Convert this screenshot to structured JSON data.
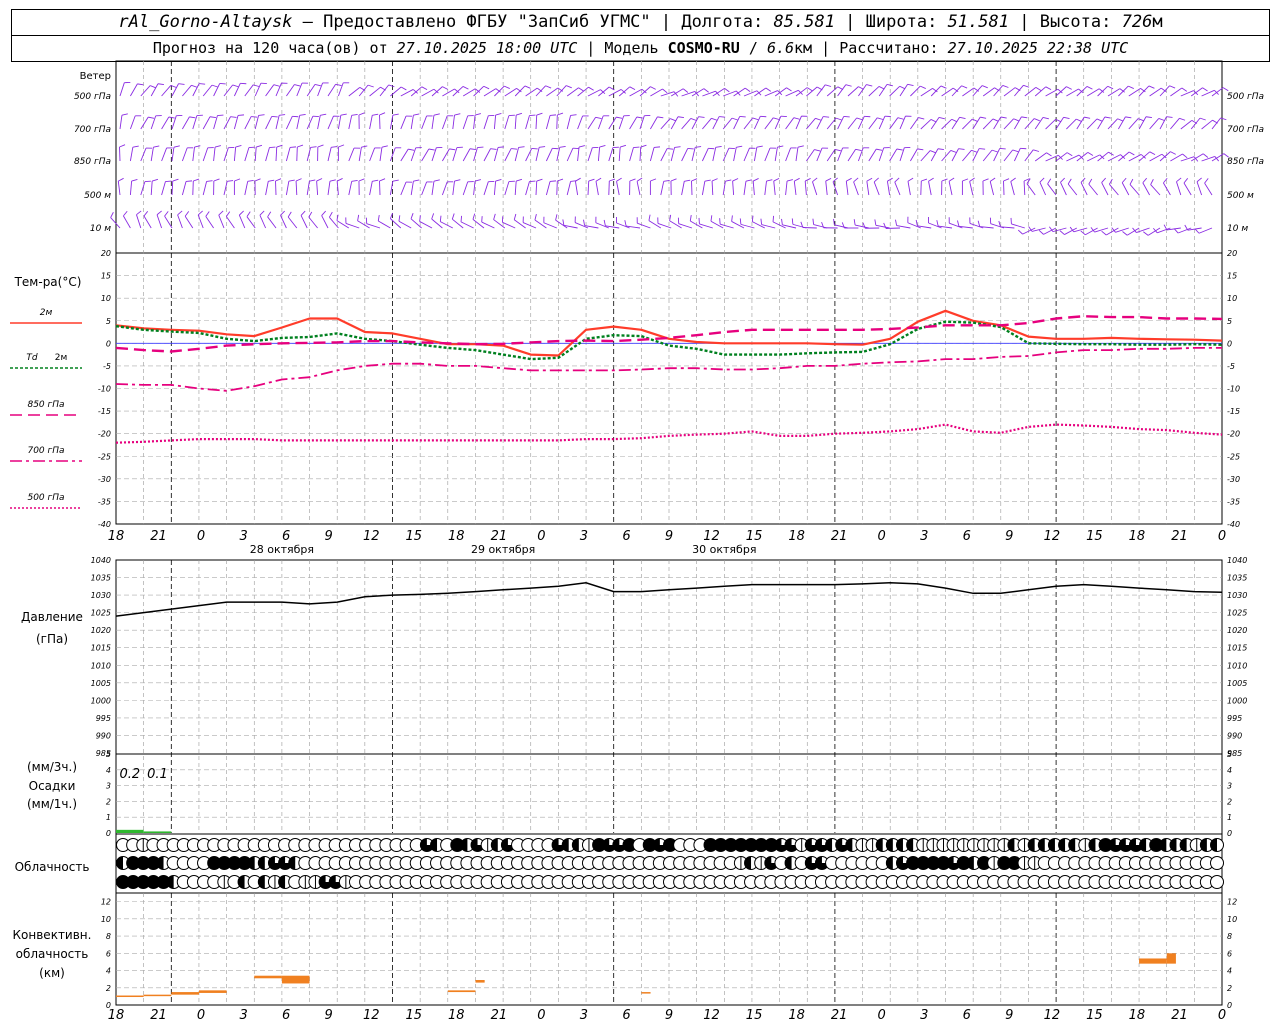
{
  "header": {
    "station": "rAl_Gorno-Altaysk",
    "provider": "Предоставлено ФГБУ \"ЗапСиб УГМС\"",
    "lon_label": "Долгота:",
    "lon": "85.581",
    "lat_label": "Широта:",
    "lat": "51.581",
    "alt_label": "Высота:",
    "alt": "726",
    "alt_unit": "м",
    "forecast_label": "Прогноз на 120 часа(ов) от",
    "forecast_start": "27.10.2025 18:00 UTC",
    "model_label": "Модель",
    "model": "COSMO-RU",
    "resolution": "6.6",
    "resolution_unit": "км",
    "computed_label": "Рассчитано:",
    "computed": "27.10.2025 22:38 UTC"
  },
  "colors": {
    "t2m": "#ff3c2a",
    "td": "#00801f",
    "t850": "#e6007e",
    "t700": "#e6007e",
    "t500": "#e6007e",
    "pressure": "#000000",
    "precip": "#2eb82e",
    "conv": "#f08020",
    "wind": "#8a2be2",
    "zero_line": "#3a3aff"
  },
  "wind_panel": {
    "title": "Ветер",
    "levels": [
      "500 гПа",
      "700 гПа",
      "850 гПа",
      "500 м",
      "10  м"
    ]
  },
  "time_axis": {
    "tick_labels": [
      "18",
      "21",
      "0",
      "3",
      "6",
      "9",
      "12",
      "15",
      "18",
      "21",
      "0",
      "3",
      "6",
      "9",
      "12",
      "15",
      "18",
      "21",
      "0",
      "3",
      "6",
      "9",
      "12",
      "15",
      "18",
      "21",
      "0"
    ],
    "dates": [
      "28 октября",
      "29 октября",
      "30 октября"
    ]
  },
  "chart_data": [
    {
      "type": "line",
      "panel": "temperature",
      "ylabel": "Тем-ра(°C)",
      "ylim": [
        -40,
        20
      ],
      "yticks": [
        20,
        15,
        10,
        5,
        0,
        -5,
        -10,
        -15,
        -20,
        -25,
        -30,
        -35,
        -40
      ],
      "x_hours": [
        0,
        3,
        6,
        9,
        12,
        15,
        18,
        21,
        24,
        27,
        30,
        33,
        36,
        39,
        42,
        45,
        48,
        51,
        54,
        57,
        60,
        63,
        66,
        69,
        72,
        75,
        78,
        81,
        84,
        87,
        90,
        93,
        96,
        99,
        102,
        105,
        108,
        111,
        114,
        117,
        120
      ],
      "series": [
        {
          "name": "2м",
          "values": [
            4,
            3.3,
            3,
            2.8,
            2,
            1.6,
            3.5,
            5.5,
            5.5,
            2.5,
            2.2,
            1,
            -0.2,
            -0.2,
            -0.5,
            -2.5,
            -2.7,
            3,
            3.7,
            3,
            1,
            0.3,
            0,
            0,
            0,
            0,
            -0.2,
            -0.3,
            1,
            4.8,
            7.2,
            5,
            4,
            1.5,
            1,
            1,
            1.2,
            1,
            0.9,
            0.8,
            0.6
          ]
        },
        {
          "name": "Td 2м",
          "values": [
            3.8,
            3,
            2.6,
            2.3,
            1,
            0.5,
            1.2,
            1.4,
            2.2,
            1,
            0.5,
            -0.3,
            -1,
            -1.5,
            -2.5,
            -3.5,
            -3.2,
            1,
            1.8,
            1.6,
            -0.5,
            -1.2,
            -2.5,
            -2.5,
            -2.5,
            -2.2,
            -2,
            -1.9,
            -0.2,
            3.2,
            4.8,
            4.6,
            3.6,
            0,
            -0.1,
            -0.2,
            -0.2,
            -0.3,
            -0.3,
            -0.2,
            -0.3
          ]
        },
        {
          "name": "850 гПа",
          "values": [
            -1,
            -1.5,
            -1.8,
            -1.2,
            -0.5,
            -0.2,
            0,
            0.1,
            0.2,
            0.5,
            0.5,
            0.2,
            0,
            -0.2,
            -0.1,
            0.2,
            0.5,
            0.6,
            0.5,
            0.8,
            1.2,
            1.8,
            2.5,
            3,
            3,
            3,
            3,
            3,
            3.2,
            3.5,
            4,
            4,
            4,
            4.5,
            5.5,
            6,
            5.8,
            5.8,
            5.5,
            5.5,
            5.4
          ]
        },
        {
          "name": "700 гПа",
          "values": [
            -9,
            -9.2,
            -9.2,
            -10,
            -10.5,
            -9.5,
            -8,
            -7.5,
            -6,
            -5,
            -4.5,
            -4.5,
            -5,
            -5,
            -5.5,
            -6,
            -6,
            -6,
            -6,
            -5.8,
            -5.5,
            -5.5,
            -5.8,
            -5.8,
            -5.5,
            -5,
            -5,
            -4.5,
            -4.2,
            -4,
            -3.5,
            -3.5,
            -3,
            -2.8,
            -2,
            -1.5,
            -1.5,
            -1.2,
            -1.2,
            -1,
            -1
          ]
        },
        {
          "name": "500 гПа",
          "values": [
            -22,
            -21.8,
            -21.5,
            -21.2,
            -21.2,
            -21.2,
            -21.5,
            -21.5,
            -21.5,
            -21.5,
            -21.5,
            -21.5,
            -21.5,
            -21.5,
            -21.5,
            -21.5,
            -21.5,
            -21.2,
            -21.2,
            -21,
            -20.5,
            -20.2,
            -20,
            -19.5,
            -20.5,
            -20.5,
            -20,
            -19.8,
            -19.5,
            -19,
            -18,
            -19.5,
            -19.8,
            -18.5,
            -18,
            -18.2,
            -18.5,
            -19,
            -19.2,
            -19.8,
            -20.2
          ]
        }
      ]
    },
    {
      "type": "line",
      "panel": "pressure",
      "ylabel": "Давление",
      "yunit": "(гПа)",
      "ylim": [
        985,
        1040
      ],
      "yticks": [
        1040,
        1035,
        1030,
        1025,
        1020,
        1015,
        1010,
        1005,
        1000,
        995,
        990,
        985
      ],
      "x_hours": [
        0,
        3,
        6,
        9,
        12,
        15,
        18,
        21,
        24,
        27,
        30,
        33,
        36,
        39,
        42,
        45,
        48,
        51,
        54,
        57,
        60,
        63,
        66,
        69,
        72,
        75,
        78,
        81,
        84,
        87,
        90,
        93,
        96,
        99,
        102,
        105,
        108,
        111,
        114,
        117,
        120
      ],
      "series": [
        {
          "name": "Давление",
          "values": [
            1024,
            1025,
            1026,
            1027,
            1028,
            1028,
            1028,
            1027.5,
            1028,
            1029.5,
            1030,
            1030.2,
            1030.5,
            1031,
            1031.5,
            1032,
            1032.5,
            1033.5,
            1031,
            1031,
            1031.5,
            1032,
            1032.5,
            1033,
            1033,
            1033,
            1033,
            1033.2,
            1033.5,
            1033.2,
            1032,
            1030.5,
            1030.5,
            1031.5,
            1032.5,
            1033,
            1032.5,
            1032,
            1031.5,
            1031,
            1030.8
          ]
        }
      ]
    },
    {
      "type": "bar",
      "panel": "precipitation",
      "ylabel": "Осадки",
      "yunit_3h": "(мм/3ч.)",
      "yunit_1h": "(мм/1ч.)",
      "ylim": [
        0,
        5
      ],
      "yticks": [
        5,
        4,
        3,
        2,
        1,
        0
      ],
      "value_labels": [
        "0.2",
        "0.1"
      ],
      "values_3h": [
        {
          "x_start": 0,
          "x_end": 3,
          "value": 0.2
        },
        {
          "x_start": 3,
          "x_end": 6,
          "value": 0.1
        }
      ]
    },
    {
      "type": "bar",
      "panel": "convective_cloud",
      "ylabel": "Конвективн. облачность (км)",
      "ylim": [
        0,
        13
      ],
      "yticks": [
        12,
        10,
        8,
        6,
        4,
        2,
        0
      ],
      "ranges_km": [
        {
          "x_start": 0,
          "x_end": 3,
          "bottom": 1,
          "top": 1.1
        },
        {
          "x_start": 3,
          "x_end": 6,
          "bottom": 1.1,
          "top": 1.2
        },
        {
          "x_start": 6,
          "x_end": 9,
          "bottom": 1.2,
          "top": 1.5
        },
        {
          "x_start": 9,
          "x_end": 12,
          "bottom": 1.4,
          "top": 1.7
        },
        {
          "x_start": 15,
          "x_end": 18,
          "bottom": 3.1,
          "top": 3.4
        },
        {
          "x_start": 18,
          "x_end": 21,
          "bottom": 2.5,
          "top": 3.4
        },
        {
          "x_start": 36,
          "x_end": 39,
          "bottom": 1.5,
          "top": 1.7
        },
        {
          "x_start": 39,
          "x_end": 40,
          "bottom": 2.6,
          "top": 2.9
        },
        {
          "x_start": 57,
          "x_end": 58,
          "bottom": 1.4,
          "top": 1.5
        },
        {
          "x_start": 111,
          "x_end": 114,
          "bottom": 4.8,
          "top": 5.4
        },
        {
          "x_start": 114,
          "x_end": 115,
          "bottom": 4.8,
          "top": 6
        }
      ]
    }
  ],
  "cloud_panel": {
    "title": "Облачность",
    "rows": [
      "upper",
      "middle",
      "lower"
    ],
    "upper": [
      0,
      0,
      1,
      0,
      0,
      0,
      0,
      0,
      0,
      0,
      0,
      0,
      0,
      0,
      0,
      0,
      0,
      0,
      0,
      0,
      0,
      0,
      0,
      0,
      0,
      0,
      0,
      0,
      0,
      0,
      3,
      2,
      0,
      4,
      2,
      3,
      1,
      2,
      3,
      0,
      0,
      0,
      0,
      3,
      2,
      2,
      1,
      4,
      3,
      3,
      4,
      0,
      4,
      3,
      4,
      0,
      0,
      0,
      4,
      4,
      4,
      4,
      4,
      4,
      4,
      3,
      3,
      1,
      3,
      3,
      2,
      3,
      2,
      1,
      1,
      2,
      2,
      2,
      2,
      1,
      1,
      1,
      1,
      1,
      1,
      1,
      1,
      1,
      2,
      1,
      2,
      2,
      2,
      2,
      2,
      1,
      2,
      4,
      3,
      3,
      3,
      2,
      4,
      2,
      2,
      2,
      1,
      2,
      2,
      2,
      1,
      2,
      2,
      2,
      2,
      2,
      3,
      3,
      2,
      2
    ],
    "middle": [
      2,
      4,
      4,
      4,
      2,
      0,
      0,
      0,
      0,
      4,
      4,
      4,
      4,
      2,
      2,
      3,
      3,
      2,
      0,
      0,
      0,
      0,
      0,
      0,
      0,
      0,
      0,
      0,
      0,
      0,
      0,
      0,
      0,
      0,
      0,
      0,
      0,
      0,
      0,
      0,
      0,
      0,
      0,
      0,
      0,
      0,
      0,
      0,
      0,
      0,
      0,
      0,
      0,
      0,
      0,
      0,
      0,
      0,
      0,
      0,
      0,
      1,
      2,
      1,
      3,
      0,
      2,
      0,
      3,
      3,
      0,
      0,
      0,
      0,
      0,
      0,
      2,
      3,
      4,
      4,
      4,
      4,
      3,
      4,
      2,
      4,
      1,
      4,
      4,
      1,
      1,
      0,
      0,
      0,
      0,
      0,
      0,
      0,
      0,
      0,
      0,
      0,
      0,
      0,
      0,
      0,
      0,
      0,
      0,
      0,
      0,
      0,
      0,
      0,
      0,
      0,
      2,
      0,
      3,
      4,
      4,
      3,
      4,
      4,
      4,
      4,
      4,
      4,
      4,
      4,
      4,
      2,
      3
    ],
    "lower": [
      4,
      4,
      4,
      4,
      4,
      2,
      0,
      0,
      0,
      0,
      1,
      0,
      2,
      0,
      2,
      1,
      2,
      0,
      1,
      1,
      3,
      3,
      1,
      0,
      0,
      0,
      0,
      0,
      0,
      0,
      0,
      0,
      0,
      0,
      0,
      0,
      0,
      0,
      0,
      0,
      0,
      0,
      0,
      0,
      0,
      0,
      0,
      0,
      0,
      0,
      0,
      0,
      0,
      0,
      0,
      0,
      0,
      0,
      0,
      0,
      0,
      0,
      0,
      0,
      0,
      0,
      0,
      0,
      0,
      0,
      0,
      0,
      0,
      0,
      0,
      0,
      0,
      0,
      0,
      0,
      0,
      0,
      0,
      0,
      0,
      0,
      0,
      0,
      0,
      0,
      0,
      0,
      0,
      0,
      0,
      0,
      0,
      0,
      0,
      0,
      0,
      0,
      0,
      0,
      0,
      0,
      0,
      0,
      0,
      0,
      0,
      0,
      0,
      0,
      0,
      0,
      0,
      0,
      0,
      0
    ]
  },
  "legend": {
    "t2m": "2м",
    "td": "Td",
    "td_level": "2м",
    "t850": "850 гПа",
    "t700": "700 гПа",
    "t500": "500 гПа"
  }
}
